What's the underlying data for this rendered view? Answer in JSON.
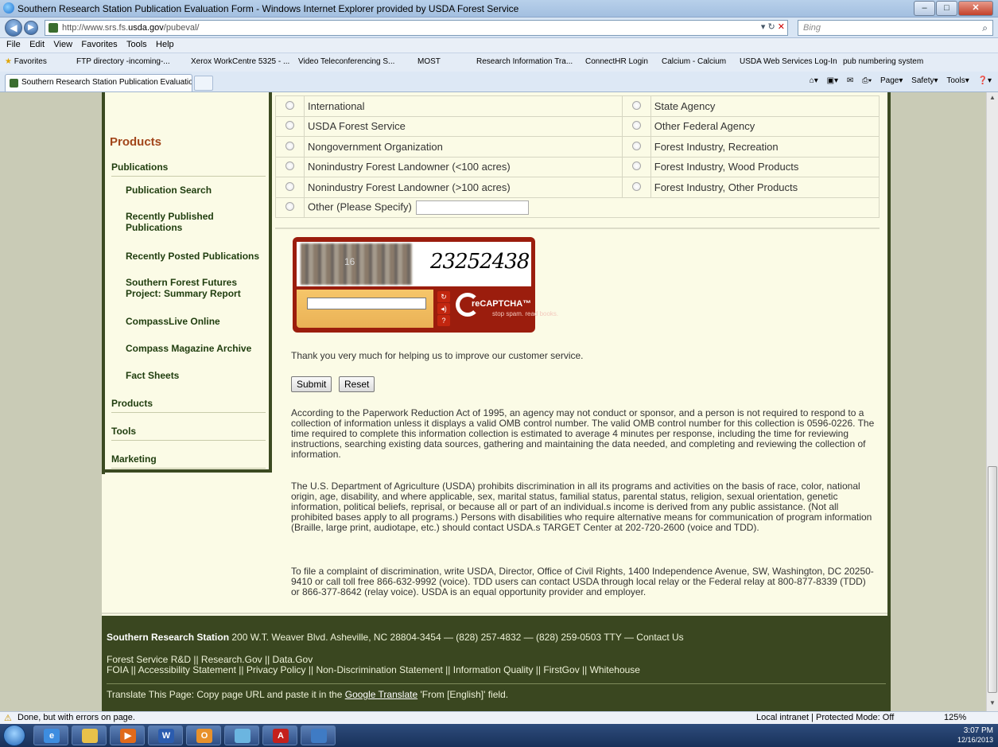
{
  "browser": {
    "window_title": "Southern Research Station Publication Evaluation Form - Windows Internet Explorer provided by USDA Forest Service",
    "url_prefix": "http://www.srs.fs.",
    "url_domain": "usda.gov",
    "url_path": "/pubeval/",
    "search_placeholder": "Bing",
    "menu": [
      "File",
      "Edit",
      "View",
      "Favorites",
      "Tools",
      "Help"
    ],
    "favorites_label": "Favorites",
    "favorites_bar": [
      "FTP directory -incoming-...",
      "Xerox WorkCentre 5325 - ...",
      "Video Teleconferencing S...",
      "MOST",
      "Research Information Tra...",
      "ConnectHR Login",
      "Calcium - Calcium",
      "USDA Web Services Log-In",
      "pub numbering system"
    ],
    "tab_title": "Southern Research Station Publication Evaluation...",
    "commands": [
      "Page",
      "Safety",
      "Tools"
    ]
  },
  "sidebar": {
    "heading": "Products",
    "items": [
      {
        "label": "Publications",
        "level": "top"
      },
      {
        "label": "Publication Search",
        "level": "sub"
      },
      {
        "label": "Recently Published Publications",
        "level": "sub"
      },
      {
        "label": "Recently Posted Publications",
        "level": "sub"
      },
      {
        "label": "Southern Forest Futures Project: Summary Report",
        "level": "sub"
      },
      {
        "label": "CompassLive Online",
        "level": "sub"
      },
      {
        "label": "Compass Magazine Archive",
        "level": "sub"
      },
      {
        "label": "Fact Sheets",
        "level": "sub"
      },
      {
        "label": "Products",
        "level": "top"
      },
      {
        "label": "Tools",
        "level": "top"
      },
      {
        "label": "Marketing",
        "level": "top"
      }
    ]
  },
  "form": {
    "options": [
      [
        "International",
        "State Agency"
      ],
      [
        "USDA Forest Service",
        "Other Federal Agency"
      ],
      [
        "Nongovernment Organization",
        "Forest Industry, Recreation"
      ],
      [
        "Nonindustry Forest Landowner (<100 acres)",
        "Forest Industry, Wood Products"
      ],
      [
        "Nonindustry Forest Landowner (>100 acres)",
        "Forest Industry, Other Products"
      ]
    ],
    "other_label": "Other (Please Specify)",
    "captcha": {
      "word": "23252438",
      "blurred_number": "16",
      "brand": "reCAPTCHA™",
      "slogan": "stop spam. read books."
    },
    "thanks": "Thank you very much for helping us to improve our customer service.",
    "submit_label": "Submit",
    "reset_label": "Reset",
    "paperwork": "According to the Paperwork Reduction Act of 1995, an agency may not conduct or sponsor, and a person is not required to respond to a collection of information unless it displays a valid OMB control number. The valid OMB control number for this collection is 0596-0226. The time required to complete this information collection is estimated to average 4 minutes per response, including the time for reviewing instructions, searching existing data sources, gathering and maintaining the data needed, and completing and reviewing the collection of information.",
    "nondiscrimination": "The U.S. Department of Agriculture (USDA) prohibits discrimination in all its programs and activities on the basis of race, color, national origin, age, disability, and where applicable, sex, marital status, familial status, parental status, religion, sexual orientation, genetic information, political beliefs, reprisal, or because all or part of an individual.s income is derived from any public assistance. (Not all prohibited bases apply to all programs.) Persons with disabilities who require alternative means for communication of program information (Braille, large print, audiotape, etc.) should contact USDA.s TARGET Center at 202-720-2600 (voice and TDD).",
    "complaint": "To file a complaint of discrimination, write USDA, Director, Office of Civil Rights, 1400 Independence Avenue, SW, Washington, DC 20250-9410 or call toll free 866-632-9992 (voice). TDD users can contact USDA through local relay or the Federal relay at 800-877-8339 (TDD) or 866-377-8642 (relay voice). USDA is an equal opportunity provider and employer."
  },
  "footer": {
    "org": "Southern Research Station",
    "address": " 200 W.T. Weaver Blvd. Asheville, NC 28804-3454 — (828) 257-4832 — (828) 259-0503 TTY — Contact Us",
    "links1": "Forest Service R&D || Research.Gov || Data.Gov",
    "links2": "FOIA || Accessibility Statement || Privacy Policy || Non-Discrimination Statement || Information Quality || FirstGov || Whitehouse",
    "translate_prefix": "Translate This Page: Copy page URL and paste it in the ",
    "translate_link": "Google Translate",
    "translate_suffix": " 'From [English]' field."
  },
  "status": {
    "left": "Done, but with errors on page.",
    "zone": "Local intranet | Protected Mode: Off",
    "zoom": "125%"
  },
  "taskbar": {
    "time": "3:07 PM",
    "date": "12/16/2013"
  },
  "colors": {
    "sidebar_heading": "#a2461b",
    "sidebar_link": "#1f3d0e",
    "footer_bg": "#3a4720",
    "page_bg": "#fbfbe6"
  }
}
